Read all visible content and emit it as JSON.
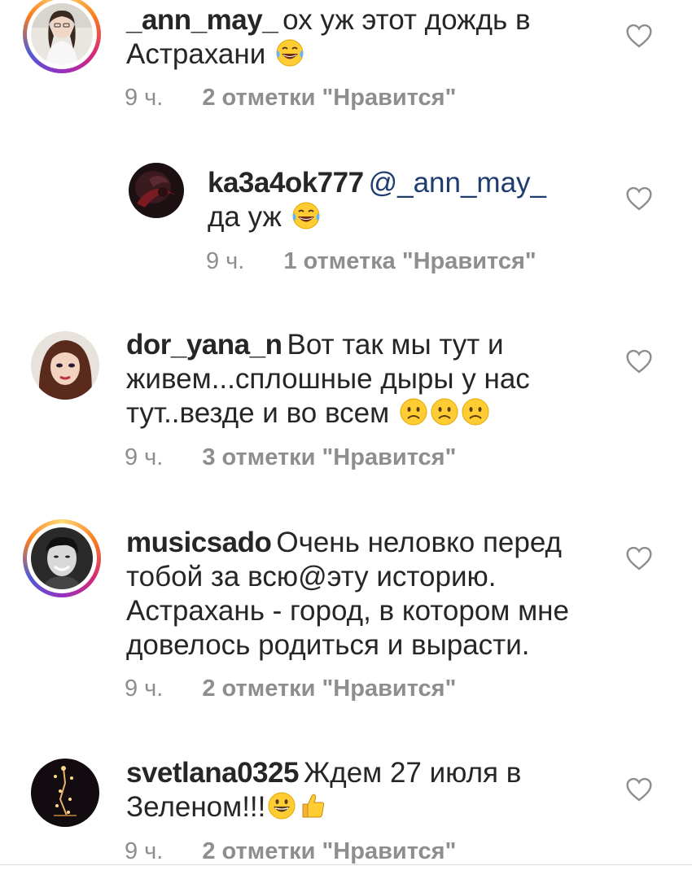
{
  "comments": [
    {
      "username": "_ann_may_",
      "text_line1": "ох уж этот дождь в",
      "text_line2": "Астрахани",
      "emoji": [
        "tears-of-joy"
      ],
      "time": "9 ч.",
      "likes": "2 отметки \"Нравится\"",
      "story_ring": true
    },
    {
      "username": "ka3a4ok777",
      "mention": "@_ann_may_",
      "text_line2": "да уж",
      "emoji": [
        "tears-of-joy"
      ],
      "time": "9 ч.",
      "likes": "1 отметка \"Нравится\"",
      "reply": true
    },
    {
      "username": "dor_yana_n",
      "text_line1": "Вот так мы тут и",
      "text_line2": "живем...сплошные дыры у нас",
      "text_line3": "тут..везде и во всем",
      "emoji": [
        "frowning",
        "frowning",
        "frowning"
      ],
      "time": "9 ч.",
      "likes": "3 отметки \"Нравится\""
    },
    {
      "username": "musicsado",
      "text_line1": "Очень неловко перед",
      "text_line2": "тобой за всю@эту историю.",
      "text_line3": "Астрахань - город, в котором мне",
      "text_line4": "довелось родиться и вырасти.",
      "time": "9 ч.",
      "likes": "2 отметки \"Нравится\"",
      "story_ring": true
    },
    {
      "username": "svetlana0325",
      "text_line1": "Ждем 27 июля в",
      "text_line2": "Зеленом!!!",
      "emoji": [
        "grinning",
        "thumbs-up"
      ],
      "time": "9 ч.",
      "likes": "2 отметки \"Нравится\""
    }
  ],
  "icons": {
    "like": "heart-outline-icon",
    "emoji_tears": "face-with-tears-of-joy",
    "emoji_frown": "frowning-face",
    "emoji_grin": "grinning-face",
    "emoji_thumb": "thumbs-up"
  },
  "colors": {
    "text": "#262626",
    "meta": "#8e8e8e",
    "mention": "#1d3d6e",
    "ring_start": "#feda75",
    "ring_end": "#d62976"
  }
}
